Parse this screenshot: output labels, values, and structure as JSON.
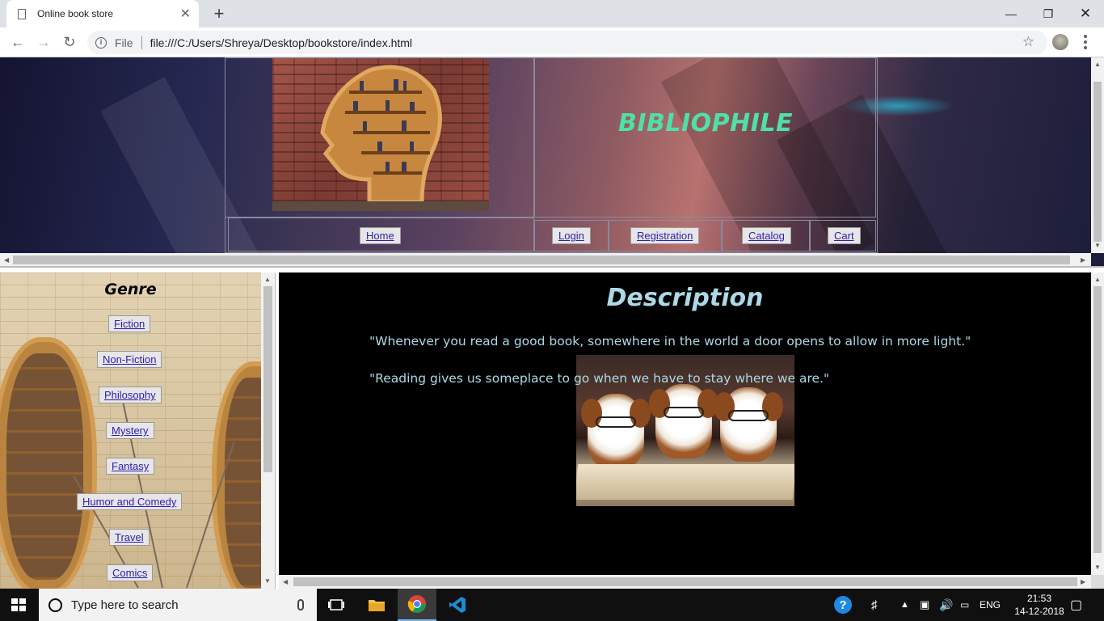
{
  "browser": {
    "tab_title": "Online book store",
    "file_label": "File",
    "url": "file:///C:/Users/Shreya/Desktop/bookstore/index.html"
  },
  "header": {
    "site_title": "BIBLIOPHILE",
    "nav": [
      "Home",
      "Login",
      "Registration",
      "Catalog",
      "Cart"
    ]
  },
  "sidebar": {
    "title": "Genre",
    "genres": [
      "Fiction",
      "Non-Fiction",
      "Philosophy",
      "Mystery",
      "Fantasy",
      "Humor and Comedy",
      "Travel",
      "Comics"
    ]
  },
  "main": {
    "title": "Description",
    "quote1": "\"Whenever you read a good book, somewhere in the world a door opens to allow in more light.\"",
    "quote2": "\"Reading gives us someplace to go when we have to stay where we are.\""
  },
  "taskbar": {
    "search_placeholder": "Type here to search",
    "lang": "ENG",
    "time": "21:53",
    "date": "14-12-2018"
  },
  "colors": {
    "site_title": "#4fe0a8",
    "description_text": "#add8e6",
    "link": "#2d1cb4"
  }
}
